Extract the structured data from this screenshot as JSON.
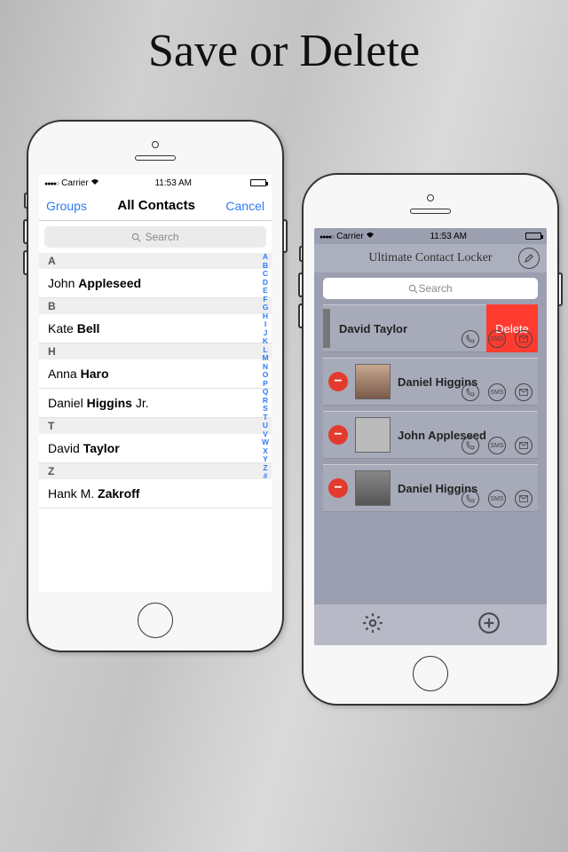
{
  "marketing_title": "Save or Delete",
  "status": {
    "carrier": "Carrier",
    "time": "11:53 AM"
  },
  "left": {
    "nav_left": "Groups",
    "nav_title": "All Contacts",
    "nav_right": "Cancel",
    "search_placeholder": "Search",
    "sections": [
      {
        "letter": "A",
        "rows": [
          {
            "first": "John",
            "last": "Appleseed"
          }
        ]
      },
      {
        "letter": "B",
        "rows": [
          {
            "first": "Kate",
            "last": "Bell"
          }
        ]
      },
      {
        "letter": "H",
        "rows": [
          {
            "first": "Anna",
            "last": "Haro"
          },
          {
            "first": "Daniel",
            "last": "Higgins",
            "suffix": "Jr."
          }
        ]
      },
      {
        "letter": "T",
        "rows": [
          {
            "first": "David",
            "last": "Taylor"
          }
        ]
      },
      {
        "letter": "Z",
        "rows": [
          {
            "first": "Hank M.",
            "last": "Zakroff"
          }
        ]
      }
    ],
    "index": [
      "A",
      "B",
      "C",
      "D",
      "E",
      "F",
      "G",
      "H",
      "I",
      "J",
      "K",
      "L",
      "M",
      "N",
      "O",
      "P",
      "Q",
      "R",
      "S",
      "T",
      "U",
      "V",
      "W",
      "X",
      "Y",
      "Z",
      "#"
    ]
  },
  "right": {
    "title": "Ultimate Contact Locker",
    "search_placeholder": "Search",
    "delete_label": "Delete",
    "action_sms": "SMS",
    "contacts": [
      {
        "name": "David Taylor",
        "swiped": true
      },
      {
        "name": "Daniel Higgins"
      },
      {
        "name": "John Appleseed"
      },
      {
        "name": "Daniel Higgins"
      }
    ]
  }
}
